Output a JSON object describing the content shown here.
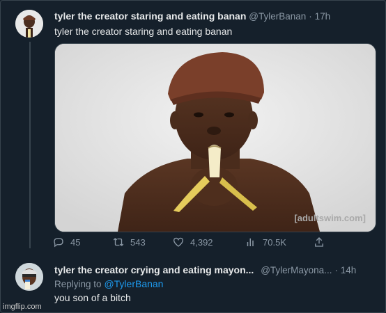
{
  "tweet1": {
    "display_name": "tyler the creator staring and eating banan",
    "handle": "@TylerBanan",
    "separator": "·",
    "time": "17h",
    "text": "tyler the creator staring and eating banan",
    "media_watermark": "[adultswim.com]",
    "avatar_icon": "profile-photo-icon",
    "actions": {
      "replies": "45",
      "retweets": "543",
      "likes": "4,392",
      "views": "70.5K"
    }
  },
  "tweet2": {
    "display_name": "tyler the creator crying and eating mayon...",
    "handle": "@TylerMayona...",
    "separator": "·",
    "time": "14h",
    "replying_prefix": "Replying to",
    "replying_handle": "@TylerBanan",
    "text": "you son of a bitch",
    "avatar_icon": "profile-photo-icon"
  },
  "watermark": "imgflip.com",
  "colors": {
    "background": "#15202b",
    "text": "#e7e9ea",
    "muted": "#8b98a5",
    "link": "#1d9bf0",
    "border": "#38444d"
  }
}
